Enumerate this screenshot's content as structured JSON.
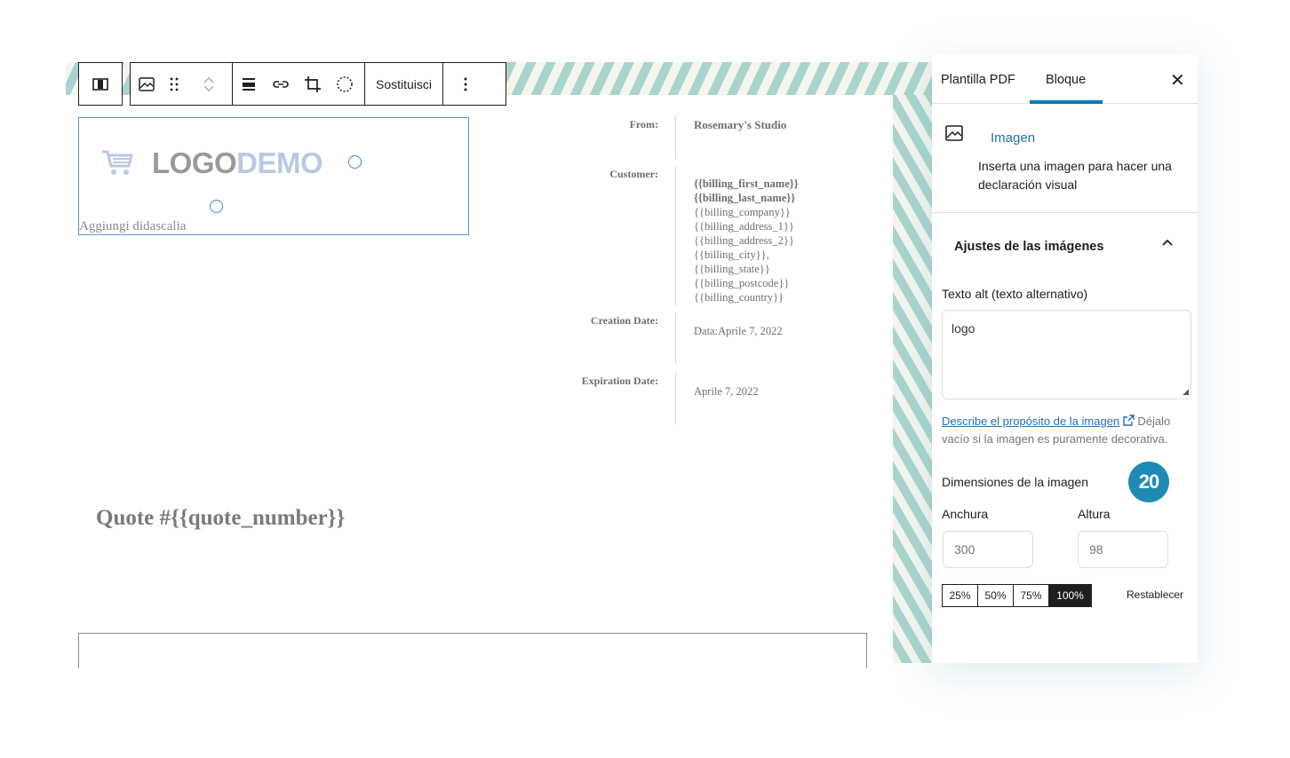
{
  "toolbar": {
    "replace_label": "Sostituisci"
  },
  "logo_block": {
    "logo_part1": "LOGO",
    "logo_part2": "DEMO",
    "caption_placeholder": "Aggiungi didascalia"
  },
  "document": {
    "rows": [
      {
        "label": "From:",
        "values": [
          "Rosemary's Studio"
        ]
      },
      {
        "label": "Customer:",
        "values": [
          "{{billing_first_name}}",
          "{{billing_last_name}}",
          "{{billing_company}}",
          "{{billing_address_1}}",
          "{{billing_address_2}}",
          "{{billing_city}},",
          "{{billing_state}}",
          "{{billing_postcode}}",
          "{{billing_country}}"
        ]
      },
      {
        "label": "Creation Date:",
        "values": [
          "Data:Aprile 7, 2022"
        ]
      },
      {
        "label": "Expiration Date:",
        "values": [
          "Aprile 7, 2022"
        ]
      }
    ],
    "quote_title": "Quote #{{quote_number}}"
  },
  "sidebar": {
    "tabs": [
      {
        "label": "Plantilla PDF"
      },
      {
        "label": "Bloque"
      }
    ],
    "block_name": "Imagen",
    "block_description": "Inserta una imagen para hacer una declaración visual",
    "panel_title": "Ajustes de las imágenes",
    "alt_label": "Texto alt (texto alternativo)",
    "alt_value": "logo",
    "help_link": "Describe el propósito de la imagen",
    "help_text": " Déjalo vacío si la imagen es puramente decorativa.",
    "dimensions_label": "Dimensiones de la imagen",
    "badge_number": "20",
    "width_label": "Anchura",
    "height_label": "Altura",
    "width_value": "300",
    "height_value": "98",
    "percent_options": [
      "25%",
      "50%",
      "75%",
      "100%"
    ],
    "percent_selected": "100%",
    "reset_label": "Restablecer"
  },
  "colors": {
    "accent": "#007cba",
    "badge": "#1e8bb4",
    "stripe": "#a9d4cd"
  }
}
